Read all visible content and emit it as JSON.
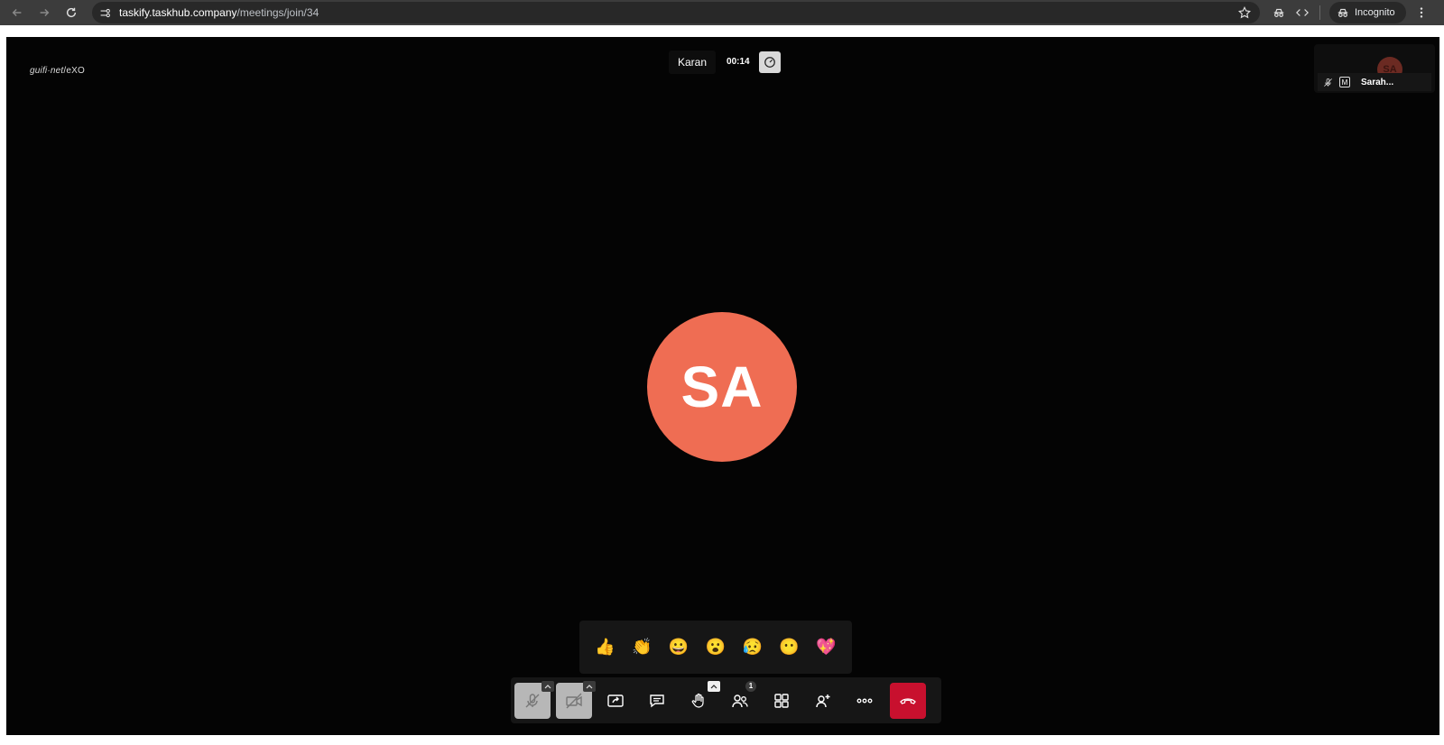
{
  "browser": {
    "url_host": "taskify.taskhub.company",
    "url_path": "/meetings/join/34",
    "incognito_label": "Incognito"
  },
  "meeting": {
    "watermark_main": "guifi·net",
    "watermark_sub": "/eXO",
    "host_name": "Karan",
    "timer": "00:14",
    "participant_thumb": {
      "initials": "SA",
      "name": "Sarah..."
    },
    "large_avatar_initials": "SA",
    "avatar_color": "#ef6d53",
    "reactions": [
      "👍",
      "👏",
      "😀",
      "😮",
      "😥",
      "😶",
      "💖"
    ],
    "participants_count": "1"
  },
  "colors": {
    "hangup": "#c8102e",
    "stage": "#040404",
    "chrome": "#3c3c3c"
  }
}
